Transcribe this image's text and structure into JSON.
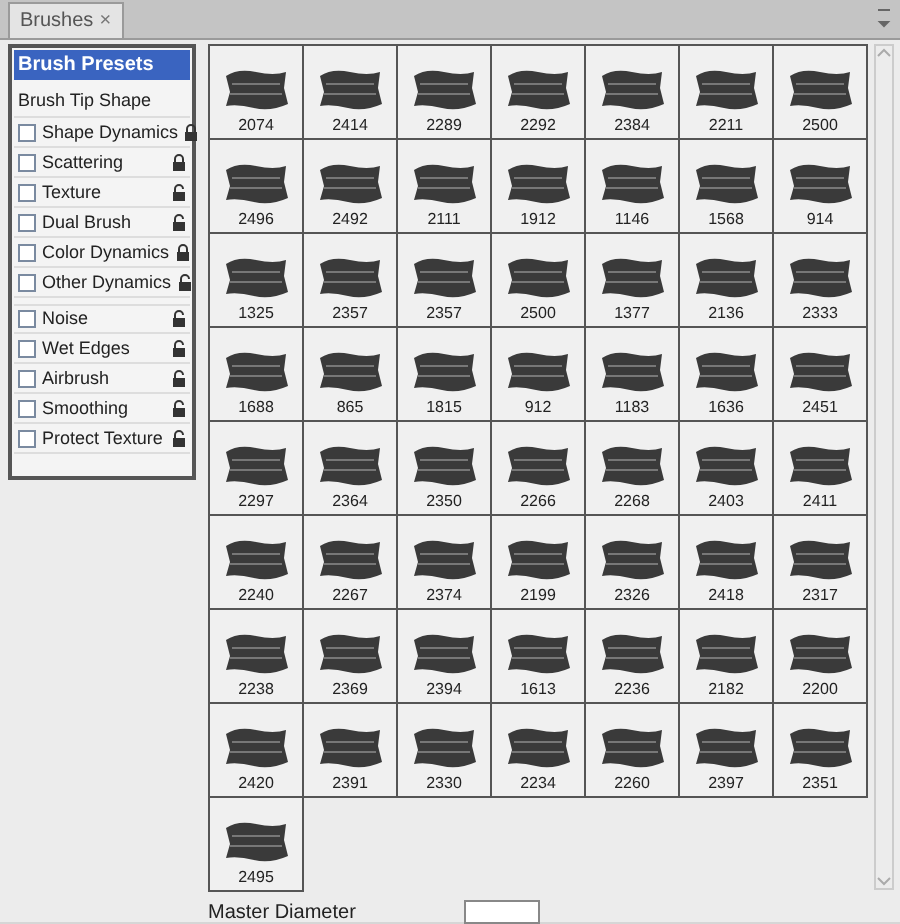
{
  "tab": {
    "label": "Brushes",
    "close": "×"
  },
  "options": [
    {
      "label": "Brush Presets",
      "kind": "header",
      "selected": true
    },
    {
      "label": "Brush Tip Shape",
      "kind": "plain",
      "selected": false
    },
    {
      "label": "Shape Dynamics",
      "kind": "option",
      "checked": false,
      "locked": true,
      "selected": false
    },
    {
      "label": "Scattering",
      "kind": "option",
      "checked": false,
      "locked": true,
      "selected": false
    },
    {
      "label": "Texture",
      "kind": "option",
      "checked": false,
      "locked": false,
      "selected": false
    },
    {
      "label": "Dual Brush",
      "kind": "option",
      "checked": false,
      "locked": false,
      "selected": false
    },
    {
      "label": "Color Dynamics",
      "kind": "option",
      "checked": false,
      "locked": true,
      "selected": false
    },
    {
      "label": "Other Dynamics",
      "kind": "option",
      "checked": false,
      "locked": false,
      "selected": false
    },
    {
      "label": "Noise",
      "kind": "option",
      "checked": false,
      "locked": false,
      "selected": false
    },
    {
      "label": "Wet Edges",
      "kind": "option",
      "checked": false,
      "locked": false,
      "selected": false
    },
    {
      "label": "Airbrush",
      "kind": "option",
      "checked": false,
      "locked": false,
      "selected": false
    },
    {
      "label": "Smoothing",
      "kind": "option",
      "checked": false,
      "locked": false,
      "selected": false
    },
    {
      "label": "Protect Texture",
      "kind": "option",
      "checked": false,
      "locked": false,
      "selected": false
    }
  ],
  "presets": [
    "2074",
    "2414",
    "2289",
    "2292",
    "2384",
    "2211",
    "2500",
    "2496",
    "2492",
    "2111",
    "1912",
    "1146",
    "1568",
    "914",
    "1325",
    "2357",
    "2357",
    "2500",
    "1377",
    "2136",
    "2333",
    "1688",
    "865",
    "1815",
    "912",
    "1183",
    "1636",
    "2451",
    "2297",
    "2364",
    "2350",
    "2266",
    "2268",
    "2403",
    "2411",
    "2240",
    "2267",
    "2374",
    "2199",
    "2326",
    "2418",
    "2317",
    "2238",
    "2369",
    "2394",
    "1613",
    "2236",
    "2182",
    "2200",
    "2420",
    "2391",
    "2330",
    "2234",
    "2260",
    "2397",
    "2351",
    "2495"
  ],
  "master_diameter": {
    "label": "Master Diameter"
  }
}
